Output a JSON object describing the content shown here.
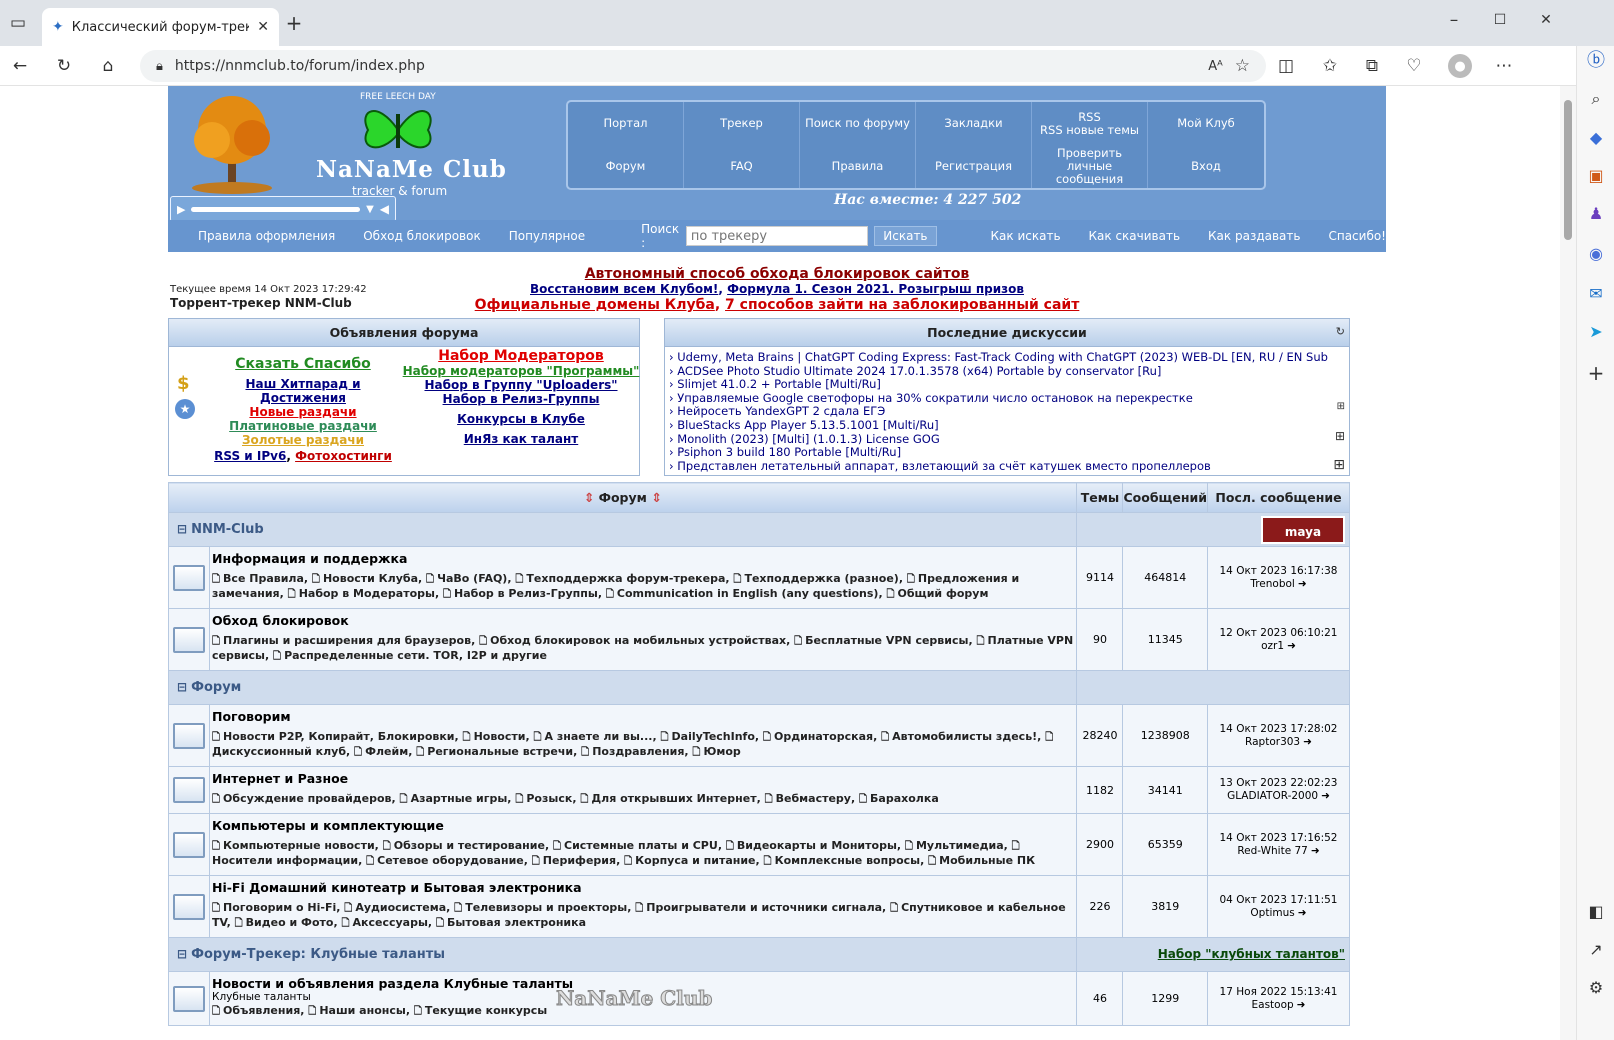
{
  "browser": {
    "tab_title": "Классический форум-трекер :: NNM",
    "url": "https://nnmclub.to/forum/index.php",
    "icons": {
      "sidebar": "sidebar-icon",
      "close": "close-icon",
      "newtab": "plus-icon",
      "back": "back-icon",
      "refresh": "refresh-icon",
      "home": "home-icon"
    }
  },
  "header": {
    "free_leech": "FREE LEECH DAY",
    "logo_text": "NaNaMe Club",
    "logo_sub": "tracker & forum",
    "together": "Нас вместе: 4 227 502",
    "nav": [
      {
        "label": "Портал"
      },
      {
        "label": "Трекер"
      },
      {
        "label": "Поиск по форуму"
      },
      {
        "label": "Закладки"
      },
      {
        "label": "RSS\nRSS новые темы"
      },
      {
        "label": "Мой Клуб"
      },
      {
        "label": "Форум"
      },
      {
        "label": "FAQ"
      },
      {
        "label": "Правила"
      },
      {
        "label": "Регистрация"
      },
      {
        "label": "Проверить личные сообщения"
      },
      {
        "label": "Вход"
      }
    ]
  },
  "subbar": {
    "links_left": [
      "Правила оформления",
      "Обход блокировок",
      "Популярное"
    ],
    "search_label": "Поиск :",
    "search_placeholder": "по трекеру",
    "search_button": "Искать",
    "links_right": [
      "Как искать",
      "Как скачивать",
      "Как раздавать",
      "Спасибо!"
    ]
  },
  "info": {
    "time": "Текущее время 14 Окт 2023 17:29:42",
    "site": "Торрент-трекер NNM-Club",
    "ann1": "Автономный способ обхода блокировок сайтов",
    "ann2a": "Восстановим всем Клубом!",
    "ann2b": "Формула 1. Сезон 2021. Розыгрыш призов",
    "ann3a": "Официальные домены Клуба",
    "ann3b": "7 способов зайти на заблокированный сайт"
  },
  "announcements": {
    "title": "Объявления форума",
    "left": [
      {
        "text": "Сказать Спасибо",
        "color": "#228b22"
      },
      {
        "text": "Наш Хитпарад и Достижения",
        "color": "#000080"
      },
      {
        "text": "Новые раздачи",
        "color": "#e00000"
      },
      {
        "text": "Платиновые раздачи",
        "color": "#2e8b57"
      },
      {
        "text": "Золотые раздачи",
        "color": "#daa520"
      }
    ],
    "left_last_a": "RSS и IPv6",
    "left_last_b": "Фотохостинги",
    "right": [
      {
        "text": "Набор Модераторов",
        "color": "#e00000"
      },
      {
        "text": "Набор модераторов \"Программы\"",
        "color": "#228b22"
      },
      {
        "text": "Набор в Группу \"Uploaders\"",
        "color": "#000080"
      },
      {
        "text": "Набор в Релиз-Группы",
        "color": "#000080"
      },
      {
        "text": "Конкурсы в Клубе",
        "color": "#000080"
      },
      {
        "text": "ИнЯз как талант",
        "color": "#000080"
      }
    ]
  },
  "discussions": {
    "title": "Последние дискуссии",
    "items": [
      "Udemy, Meta Brains | ChatGPT Coding Express: Fast-Track Coding with ChatGPT (2023) WEB-DL [EN, RU / EN Sub]",
      "ACDSee Photo Studio Ultimate 2024 17.0.1.3578 (x64) Portable by conservator [Ru]",
      "Slimjet 41.0.2 + Portable [Multi/Ru]",
      "Управляемые Google светофоры на 30% сократили число остановок на перекрестке",
      "Нейросеть YandexGPT 2 сдала ЕГЭ",
      "BlueStacks App Player 5.13.5.1001 [Multi/Ru]",
      "Monolith (2023) [Multi] (1.0.1.3) License GOG",
      "Psiphon 3 build 180 Portable [Multi/Ru]",
      "Представлен летательный аппарат, взлетающий за счёт катушек вместо пропеллеров"
    ]
  },
  "table": {
    "headers": {
      "forum": "Форум",
      "topics": "Темы",
      "posts": "Сообщений",
      "last": "Посл. сообщение"
    },
    "categories": [
      {
        "name": "NNM-Club",
        "right": "",
        "forums": [
          {
            "name": "Информация и поддержка",
            "desc": "",
            "subs": [
              "Все Правила",
              "Новости Клуба",
              "ЧаВо (FAQ)",
              "Техподдержка форум-трекера",
              "Техподдержка (разное)",
              "Предложения и замечания",
              "Набор в Модераторы",
              "Набор в Релиз-Группы",
              "Communication in English (any questions)",
              "Общий форум"
            ],
            "topics": "9114",
            "posts": "464814",
            "date": "14 Окт 2023 16:17:38",
            "user": "Trenobol"
          },
          {
            "name": "Обход блокировок",
            "desc": "",
            "subs": [
              "Плагины и расширения для браузеров",
              "Обход блокировок на мобильных устройствах",
              "Бесплатные VPN сервисы",
              "Платные VPN сервисы",
              "Распределенные сети. TOR, I2P и другие"
            ],
            "topics": "90",
            "posts": "11345",
            "date": "12 Окт 2023 06:10:21",
            "user": "ozr1"
          }
        ]
      },
      {
        "name": "Форум",
        "right": "",
        "forums": [
          {
            "name": "Поговорим",
            "desc": "",
            "subs": [
              "Новости P2P, Копирайт, Блокировки",
              "Новости",
              "А знаете ли вы...",
              "DailyTechInfo",
              "Ординаторская",
              "Автомобилисты здесь!",
              "Дискуссионный клуб",
              "Флейм",
              "Региональные встречи",
              "Поздравления",
              "Юмор"
            ],
            "topics": "28240",
            "posts": "1238908",
            "date": "14 Окт 2023 17:28:02",
            "user": "Raptor303"
          },
          {
            "name": "Интернет и Разное",
            "desc": "",
            "subs": [
              "Обсуждение провайдеров",
              "Азартные игры",
              "Розыск",
              "Для открывших Интернет",
              "Вебмастеру",
              "Барахолка"
            ],
            "topics": "1182",
            "posts": "34141",
            "date": "13 Окт 2023 22:02:23",
            "user": "GLADIATOR-2000"
          },
          {
            "name": "Компьютеры и комплектующие",
            "desc": "",
            "subs": [
              "Компьютерные новости",
              "Обзоры и тестирование",
              "Системные платы и CPU",
              "Видеокарты и Мониторы",
              "Мультимедиа",
              "Носители информации",
              "Сетевое оборудование",
              "Периферия",
              "Корпуса и питание",
              "Комплексные вопросы",
              "Мобильные ПК"
            ],
            "topics": "2900",
            "posts": "65359",
            "date": "14 Окт 2023 17:16:52",
            "user": "Red-White 77"
          },
          {
            "name": "Hi-Fi Домашний кинотеатр и Бытовая электроника",
            "desc": "",
            "subs": [
              "Поговорим о Hi-Fi",
              "Аудиосистема",
              "Телевизоры и проекторы",
              "Проигрыватели и источники сигнала",
              "Спутниковое и кабельное TV",
              "Видео и Фото",
              "Аксессуары",
              "Бытовая электроника"
            ],
            "topics": "226",
            "posts": "3819",
            "date": "04 Окт 2023 17:11:51",
            "user": "Optimus"
          }
        ]
      },
      {
        "name": "Форум-Трекер: Клубные таланты",
        "right": "Набор \"клубных талантов\"",
        "forums": [
          {
            "name": "Новости и объявления раздела Клубные таланты",
            "desc": "Клубные таланты",
            "subs": [
              "Объявления",
              "Наши анонсы",
              "Текущие конкурсы"
            ],
            "topics": "46",
            "posts": "1299",
            "date": "17 Ноя 2022 15:13:41",
            "user": "Eastoop"
          }
        ]
      }
    ]
  },
  "watermark": "NaNaMe Club",
  "colors": {
    "header": "#6f9bd1",
    "nav": "#5f8dc5",
    "category": "#cfdced",
    "row": "#f2f6fb"
  }
}
